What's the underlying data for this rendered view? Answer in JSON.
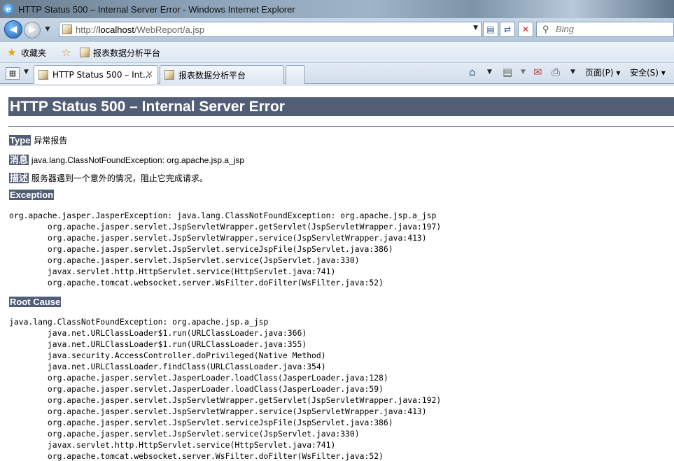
{
  "window": {
    "title": "HTTP Status 500 – Internal Server Error - Windows Internet Explorer"
  },
  "address": {
    "url_prefix": "http://",
    "url_host": "localhost",
    "url_path": "/WebReport/a.jsp",
    "search_placeholder": "Bing"
  },
  "favorites": {
    "label": "收藏夹",
    "link": "报表数据分析平台"
  },
  "tabs": [
    {
      "label": "HTTP Status 500 – Int...",
      "active": true
    },
    {
      "label": "报表数据分析平台",
      "active": false
    }
  ],
  "commands": {
    "page": "页面(P)",
    "safety": "安全(S)"
  },
  "page": {
    "title": "HTTP Status 500 – Internal Server Error",
    "type_label": "Type",
    "type_value": "异常报告",
    "message_label": "消息",
    "message_value": "java.lang.ClassNotFoundException: org.apache.jsp.a_jsp",
    "description_label": "描述",
    "description_value": "服务器遇到一个意外的情况，阻止它完成请求。",
    "exception_label": "Exception",
    "exception_trace": "org.apache.jasper.JasperException: java.lang.ClassNotFoundException: org.apache.jsp.a_jsp\n\torg.apache.jasper.servlet.JspServletWrapper.getServlet(JspServletWrapper.java:197)\n\torg.apache.jasper.servlet.JspServletWrapper.service(JspServletWrapper.java:413)\n\torg.apache.jasper.servlet.JspServlet.serviceJspFile(JspServlet.java:386)\n\torg.apache.jasper.servlet.JspServlet.service(JspServlet.java:330)\n\tjavax.servlet.http.HttpServlet.service(HttpServlet.java:741)\n\torg.apache.tomcat.websocket.server.WsFilter.doFilter(WsFilter.java:52)",
    "root_cause_label": "Root Cause",
    "root_cause_trace": "java.lang.ClassNotFoundException: org.apache.jsp.a_jsp\n\tjava.net.URLClassLoader$1.run(URLClassLoader.java:366)\n\tjava.net.URLClassLoader$1.run(URLClassLoader.java:355)\n\tjava.security.AccessController.doPrivileged(Native Method)\n\tjava.net.URLClassLoader.findClass(URLClassLoader.java:354)\n\torg.apache.jasper.servlet.JasperLoader.loadClass(JasperLoader.java:128)\n\torg.apache.jasper.servlet.JasperLoader.loadClass(JasperLoader.java:59)\n\torg.apache.jasper.servlet.JspServletWrapper.getServlet(JspServletWrapper.java:192)\n\torg.apache.jasper.servlet.JspServletWrapper.service(JspServletWrapper.java:413)\n\torg.apache.jasper.servlet.JspServlet.serviceJspFile(JspServlet.java:386)\n\torg.apache.jasper.servlet.JspServlet.service(JspServlet.java:330)\n\tjavax.servlet.http.HttpServlet.service(HttpServlet.java:741)\n\torg.apache.tomcat.websocket.server.WsFilter.doFilter(WsFilter.java:52)"
  },
  "colors": {
    "tomcat_header": "#525d76"
  }
}
